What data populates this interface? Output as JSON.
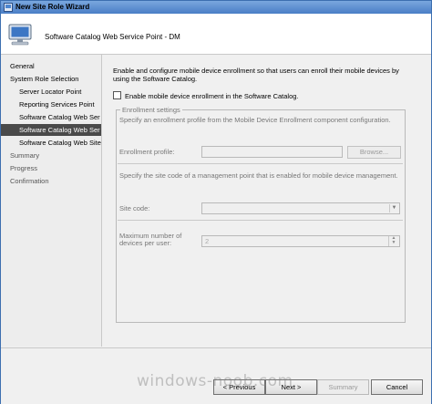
{
  "window": {
    "title": "New Site Role Wizard"
  },
  "header": {
    "title": "Software Catalog Web Service Point - DM"
  },
  "nav": {
    "items": [
      {
        "label": "General"
      },
      {
        "label": "System Role Selection"
      },
      {
        "label": "Server Locator Point"
      },
      {
        "label": "Reporting Services Point"
      },
      {
        "label": "Software Catalog Web Ser"
      },
      {
        "label": "Software Catalog Web Ser"
      },
      {
        "label": "Software Catalog Web Site"
      },
      {
        "label": "Summary"
      },
      {
        "label": "Progress"
      },
      {
        "label": "Confirmation"
      }
    ]
  },
  "content": {
    "description": "Enable and configure mobile device enrollment so that users can enroll their mobile devices by using the Software Catalog.",
    "enable_checkbox": {
      "label": "Enable mobile device enrollment in the Software Catalog.",
      "checked": false
    },
    "enrollment_settings": {
      "legend": "Enrollment settings",
      "profile_text": "Specify an enrollment profile from the Mobile Device Enrollment component configuration.",
      "profile_label": "Enrollment profile:",
      "profile_value": "",
      "browse_label": "Browse...",
      "site_text": "Specify the site code of a management point that is enabled for mobile device management.",
      "site_label": "Site code:",
      "site_value": "",
      "max_label_1": "Maximum number of",
      "max_label_2": "devices per user:",
      "max_value": "2"
    }
  },
  "footer": {
    "previous": "< Previous",
    "next": "Next >",
    "summary": "Summary",
    "cancel": "Cancel"
  },
  "watermark": "windows-noob.com"
}
